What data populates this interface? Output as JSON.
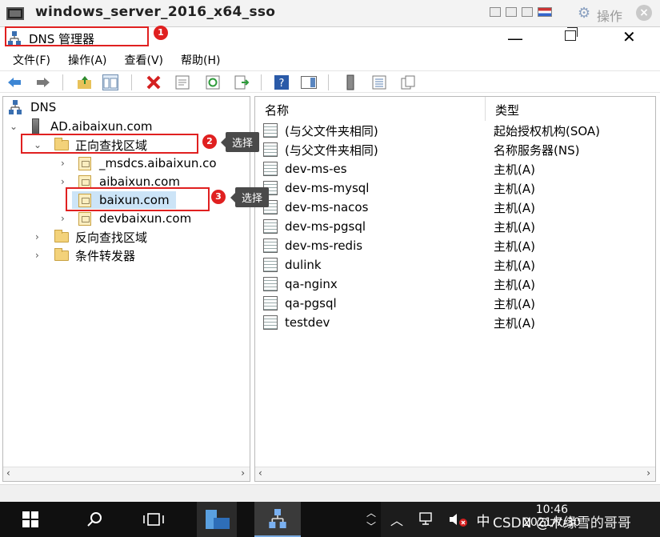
{
  "vm_window": {
    "title": "windows_server_2016_x64_sso",
    "ops_label": "操作"
  },
  "app": {
    "title": "DNS 管理器"
  },
  "menu": [
    {
      "label": "文件(F)"
    },
    {
      "label": "操作(A)"
    },
    {
      "label": "查看(V)"
    },
    {
      "label": "帮助(H)"
    }
  ],
  "tree": {
    "root": "DNS",
    "server": "AD.aibaixun.com",
    "forward_zone": "正向查找区域",
    "zones": [
      "_msdcs.aibaixun.co",
      "aibaixun.com",
      "baixun.com",
      "devbaixun.com"
    ],
    "reverse_zone": "反向查找区域",
    "conditional_forwarders": "条件转发器"
  },
  "list": {
    "columns": [
      "名称",
      "类型"
    ],
    "rows": [
      {
        "name": "(与父文件夹相同)",
        "type": "起始授权机构(SOA)"
      },
      {
        "name": "(与父文件夹相同)",
        "type": "名称服务器(NS)"
      },
      {
        "name": "dev-ms-es",
        "type": "主机(A)"
      },
      {
        "name": "dev-ms-mysql",
        "type": "主机(A)"
      },
      {
        "name": "dev-ms-nacos",
        "type": "主机(A)"
      },
      {
        "name": "dev-ms-pgsql",
        "type": "主机(A)"
      },
      {
        "name": "dev-ms-redis",
        "type": "主机(A)"
      },
      {
        "name": "dulink",
        "type": "主机(A)"
      },
      {
        "name": "qa-nginx",
        "type": "主机(A)"
      },
      {
        "name": "qa-pgsql",
        "type": "主机(A)"
      },
      {
        "name": "testdev",
        "type": "主机(A)"
      }
    ]
  },
  "annotations": {
    "step1": "1",
    "step2": "2",
    "step3": "3",
    "tip2": "选择",
    "tip3": "选择"
  },
  "taskbar": {
    "time": "10:46",
    "date": "2021/7/30",
    "ime": "中",
    "watermark": "CSDN @木缘雪的哥哥"
  }
}
